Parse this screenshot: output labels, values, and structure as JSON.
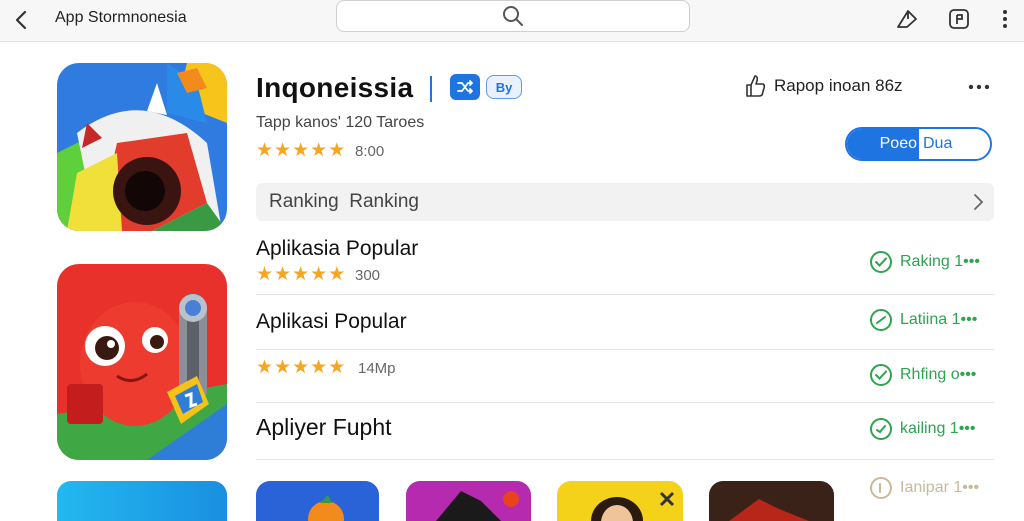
{
  "topbar": {
    "title": "App Stormnonesia",
    "icons": [
      "chevron-left-icon",
      "search-icon",
      "share-icon",
      "bookmark-icon",
      "more-vertical-icon"
    ]
  },
  "app": {
    "name": "Inqoneissia",
    "badge_label": "By",
    "subtitle": "Tapp kanos' 120 Taroes",
    "rating_text": "8:00",
    "like_label": "Rapop inoan 86z",
    "pill_left": "Poeo",
    "pill_right": "Dua"
  },
  "ranking": {
    "label": "Ranking  Ranking"
  },
  "rows": [
    {
      "title": "Aplikasia Popular",
      "rating_text": "300",
      "status": "Raking 1•••"
    },
    {
      "title": "Aplikasi Popular",
      "status": "Latiina 1•••"
    },
    {
      "rating_text": "14Mp",
      "status": "Rhfing o•••"
    },
    {
      "title": "Apliyer Fupht",
      "status": "kailing 1•••"
    },
    {
      "status": "Ianipar 1•••"
    }
  ],
  "colors": {
    "accent": "#1e74e0",
    "star": "#f5a623",
    "status_green": "#2ea44f"
  }
}
